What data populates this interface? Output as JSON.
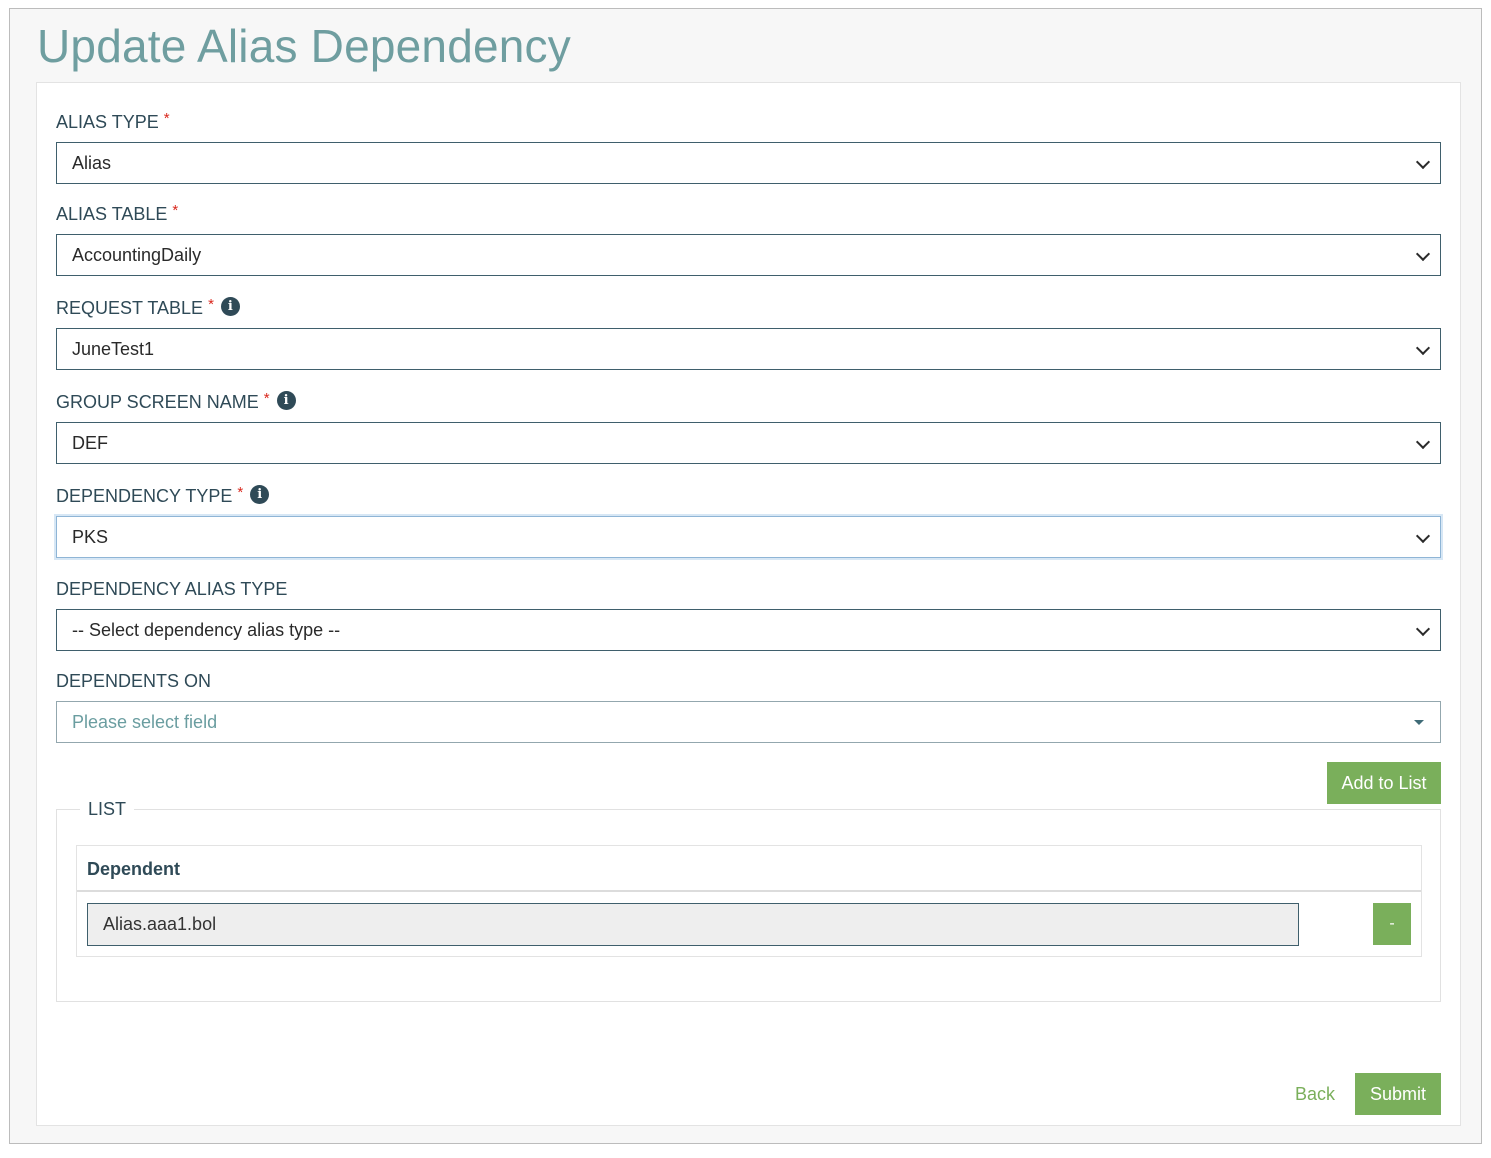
{
  "page": {
    "title": "Update Alias Dependency"
  },
  "fields": {
    "alias_type": {
      "label": "ALIAS TYPE",
      "required": "*",
      "value": "Alias"
    },
    "alias_table": {
      "label": "ALIAS TABLE",
      "required": "*",
      "value": "AccountingDaily"
    },
    "request_table": {
      "label": "REQUEST TABLE",
      "required": "*",
      "value": "JuneTest1"
    },
    "group_screen_name": {
      "label": "GROUP SCREEN NAME",
      "required": "*",
      "value": "DEF"
    },
    "dependency_type": {
      "label": "DEPENDENCY TYPE",
      "required": "*",
      "value": "PKS"
    },
    "dependency_alias_type": {
      "label": "DEPENDENCY ALIAS TYPE",
      "value": "-- Select dependency alias type --"
    },
    "dependents_on": {
      "label": "DEPENDENTS ON",
      "placeholder": "Please select field"
    }
  },
  "info_icon_glyph": "i",
  "add_to_list_label": "Add to List",
  "list": {
    "legend": "LIST",
    "column_header": "Dependent",
    "rows": [
      {
        "value": "Alias.aaa1.bol",
        "remove_label": "-"
      }
    ]
  },
  "actions": {
    "back_label": "Back",
    "submit_label": "Submit"
  },
  "colors": {
    "accent_green": "#7aaf5b",
    "title_teal": "#6f9ea0",
    "text_dark": "#2f4a57",
    "required_red": "#d9271c"
  },
  "icons": {
    "info": "info-circle-icon",
    "select_arrow": "chevron-down-icon",
    "dropdown_caret": "caret-down-icon"
  }
}
